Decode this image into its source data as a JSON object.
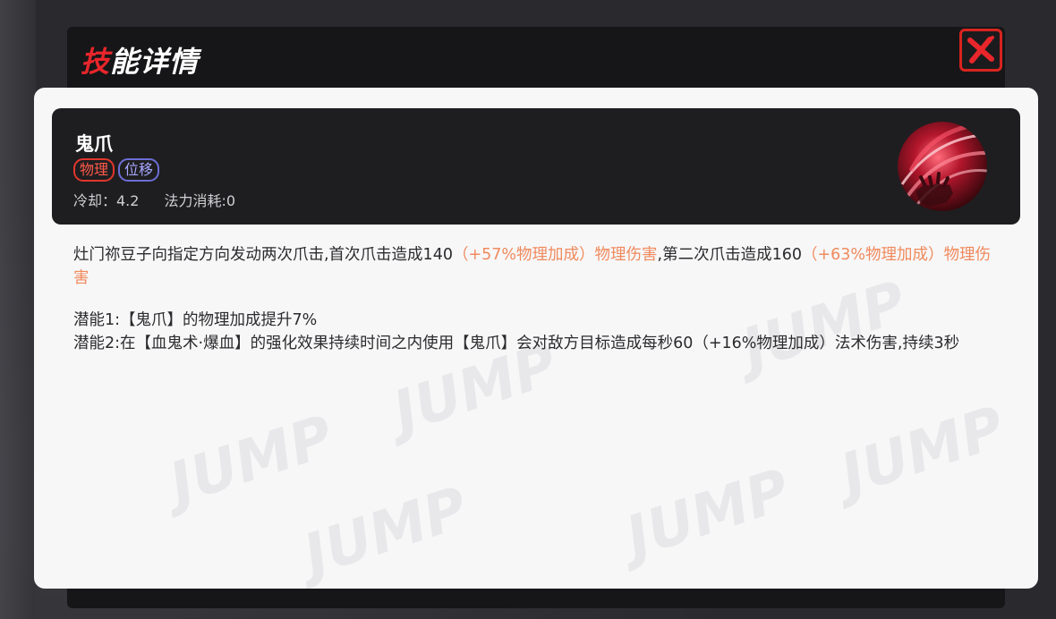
{
  "dialog": {
    "title_accent": "技",
    "title_rest": "能详情"
  },
  "skill": {
    "name": "鬼爪",
    "tags": [
      "物理",
      "位移"
    ],
    "cooldown": "冷却：4.2",
    "mana_cost": "法力消耗:0",
    "icon": "claw-skill-icon"
  },
  "description": {
    "part1": "灶门祢豆子向指定方向发动两次爪击,首次爪击造成140",
    "scale1": "（+57%物理加成）",
    "part2": "物理伤害,第二次爪击造成160",
    "scale2": "（+63%物理加成）",
    "part3": "物理伤害"
  },
  "potentials": [
    "潜能1:【鬼爪】的物理加成提升7%",
    "潜能2:在【血鬼术·爆血】的强化效果持续时间之内使用【鬼爪】会对敌方目标造成每秒60（+16%物理加成）法术伤害,持续3秒"
  ],
  "colors": {
    "accent_red": "#e8262b",
    "scaling_orange": "#f08a5d",
    "tag_physical": "#ff5a4a",
    "tag_move": "#a7a7ff"
  },
  "watermark": [
    "JUMP",
    "JUMP",
    "JUMP",
    "JUMP",
    "JUMP",
    "JUMP"
  ]
}
